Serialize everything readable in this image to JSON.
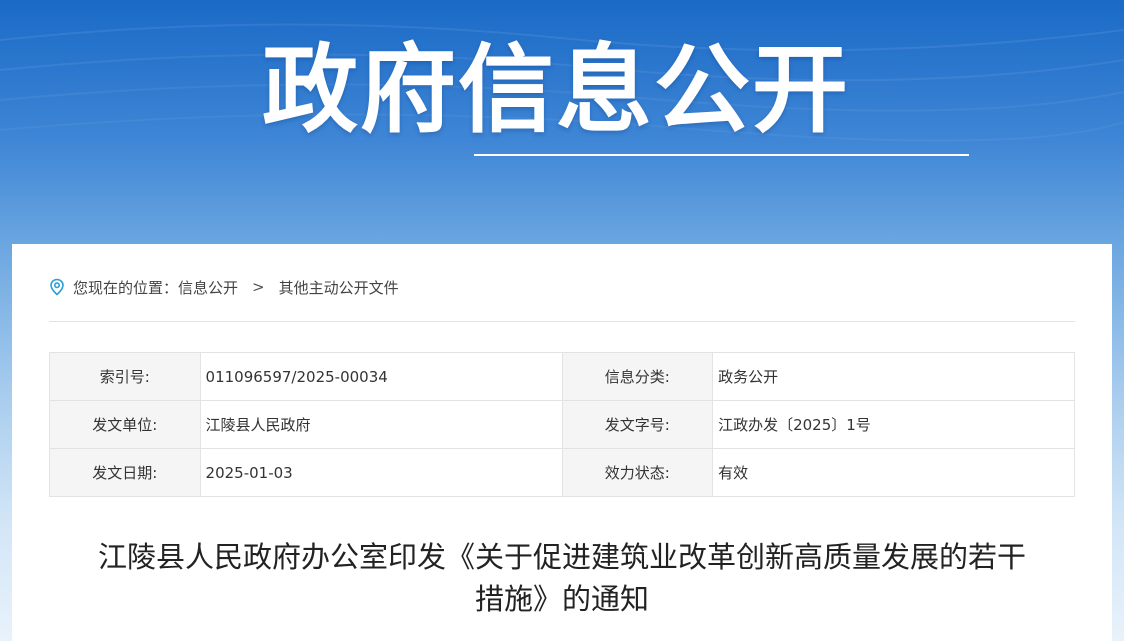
{
  "banner": {
    "title": "政府信息公开"
  },
  "breadcrumb": {
    "prefix": "您现在的位置：",
    "items": [
      "信息公开",
      "其他主动公开文件"
    ],
    "separator": ">"
  },
  "meta": {
    "rows": [
      {
        "label1": "索引号:",
        "value1": "011096597/2025-00034",
        "label2": "信息分类:",
        "value2": "政务公开"
      },
      {
        "label1": "发文单位:",
        "value1": "江陵县人民政府",
        "label2": "发文字号:",
        "value2": "江政办发〔2025〕1号"
      },
      {
        "label1": "发文日期:",
        "value1": "2025-01-03",
        "label2": "效力状态:",
        "value2": "有效"
      }
    ]
  },
  "document": {
    "title_line1": "江陵县人民政府办公室印发《关于促进建筑业改革创新高质量发展的若干",
    "title_line2": "措施》的通知"
  },
  "colors": {
    "banner_top": "#1a6ac6",
    "icon_accent": "#2a9fd6",
    "label_bg": "#f5f5f5",
    "border": "#e3e3e3"
  }
}
